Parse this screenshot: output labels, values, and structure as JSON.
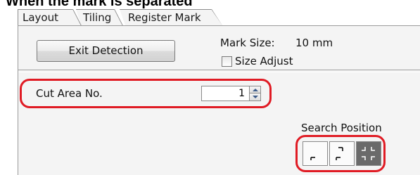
{
  "caption": "When the mark is separated",
  "tabs": [
    {
      "label": "Layout"
    },
    {
      "label": "Tiling"
    },
    {
      "label": "Register Mark"
    }
  ],
  "panel": {
    "exit_button": "Exit Detection",
    "mark_size_label": "Mark Size:",
    "mark_size_value": "10 mm",
    "size_adjust_label": "Size Adjust",
    "size_adjust_checked": false,
    "cut_area_label": "Cut Area No.",
    "cut_area_value": "1",
    "search_position_label": "Search Position",
    "search_positions": [
      {
        "icon": "corner-bottom-left-icon",
        "selected": false
      },
      {
        "icon": "corner-top-right-bottom-left-icon",
        "selected": false
      },
      {
        "icon": "four-corners-icon",
        "selected": true
      }
    ]
  },
  "highlight_color": "#e01b24"
}
